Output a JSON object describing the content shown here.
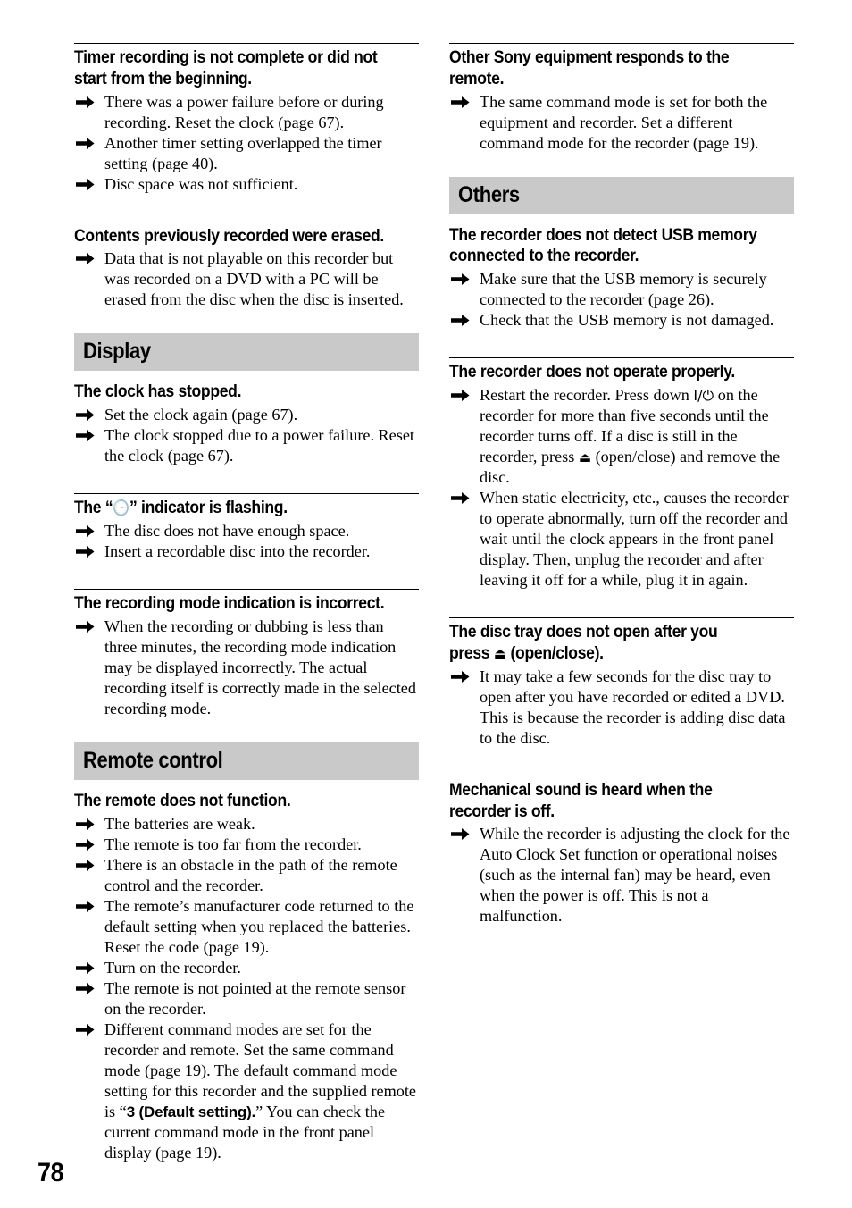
{
  "page": {
    "number": "78"
  },
  "icons": {
    "arrow": "arrow-right-icon",
    "clock": "clock-icon",
    "power": "power-icon",
    "eject": "eject-icon"
  },
  "left_column": {
    "blocks": [
      {
        "kind": "qa",
        "heading": "Timer recording is not complete or did not start from the beginning.",
        "items": [
          "There was a power failure before or during recording. Reset the clock (page 67).",
          "Another timer setting overlapped the timer setting (page 40).",
          "Disc space was not sufficient."
        ]
      },
      {
        "kind": "qa",
        "heading": "Contents previously recorded were erased.",
        "items": [
          "Data that is not playable on this recorder but was recorded on a DVD with a PC will be erased from the disc when the disc is inserted."
        ]
      },
      {
        "kind": "band",
        "title": "Display"
      },
      {
        "kind": "qa",
        "heading": "The clock has stopped.",
        "items": [
          "Set the clock again (page 67).",
          "The clock stopped due to a power failure. Reset the clock (page 67)."
        ]
      },
      {
        "kind": "qa-clock",
        "heading_pre": "The “",
        "heading_symbol": "🕒",
        "heading_post": "” indicator is flashing.",
        "items": [
          "The disc does not have enough space.",
          "Insert a recordable disc into the recorder."
        ]
      },
      {
        "kind": "qa",
        "heading": "The recording mode indication is incorrect.",
        "items": [
          "When the recording or dubbing is less than three minutes, the recording mode indication may be displayed incorrectly. The actual recording itself is correctly made in the selected recording mode."
        ]
      },
      {
        "kind": "band",
        "title": "Remote control"
      },
      {
        "kind": "qa-remote",
        "heading": "The remote does not function.",
        "items": [
          "The batteries are weak.",
          "The remote is too far from the recorder.",
          "There is an obstacle in the path of the remote control and the recorder.",
          "The remote’s manufacturer code returned to the default setting when you replaced the batteries. Reset the code (page 19).",
          "Turn on the recorder.",
          "The remote is not pointed at the remote sensor on the recorder."
        ],
        "last_item": {
          "pre": "Different command modes are set for the recorder and remote. Set the same command mode (page 19). The default command mode setting for this recorder and the supplied remote is “",
          "bold": "3 (Default setting).",
          "post": "” You can check the current command mode in the front panel display (page 19)."
        }
      }
    ]
  },
  "right_column": {
    "blocks": [
      {
        "kind": "qa",
        "heading": "Other Sony equipment responds to the remote.",
        "items": [
          "The same command mode is set for both the equipment and recorder. Set a different command mode for the recorder (page 19)."
        ]
      },
      {
        "kind": "band",
        "title": "Others"
      },
      {
        "kind": "qa",
        "heading": "The recorder does not detect USB memory connected to the recorder.",
        "items": [
          "Make sure that the USB memory is securely connected to the recorder (page 26).",
          "Check that the USB memory is not damaged."
        ]
      },
      {
        "kind": "qa-operate",
        "heading": "The recorder does not operate properly.",
        "item1": {
          "pre": "Restart the recorder. Press down ",
          "sym_power": "I/⏻",
          "mid": " on the recorder for more than five seconds until the recorder turns off. If a disc is still in the recorder, press ",
          "sym_eject": "⏏",
          "post": " (open/close) and remove the disc."
        },
        "item2": "When static electricity, etc., causes the recorder to operate abnormally, turn off the recorder and wait until the clock appears in the front panel display. Then, unplug the recorder and after leaving it off for a while, plug it in again."
      },
      {
        "kind": "qa-tray",
        "heading_pre": "The disc tray does not open after you press ",
        "heading_symbol": "⏏",
        "heading_post": " (open/close).",
        "items": [
          "It may take a few seconds for the disc tray to open after you have recorded or edited a DVD. This is because the recorder is adding disc data to the disc."
        ]
      },
      {
        "kind": "qa",
        "heading": "Mechanical sound is heard when the recorder is off.",
        "items": [
          "While the recorder is adjusting the clock for the Auto Clock Set function or operational noises (such as the internal fan) may be heard, even when the power is off. This is not a malfunction."
        ]
      }
    ]
  }
}
